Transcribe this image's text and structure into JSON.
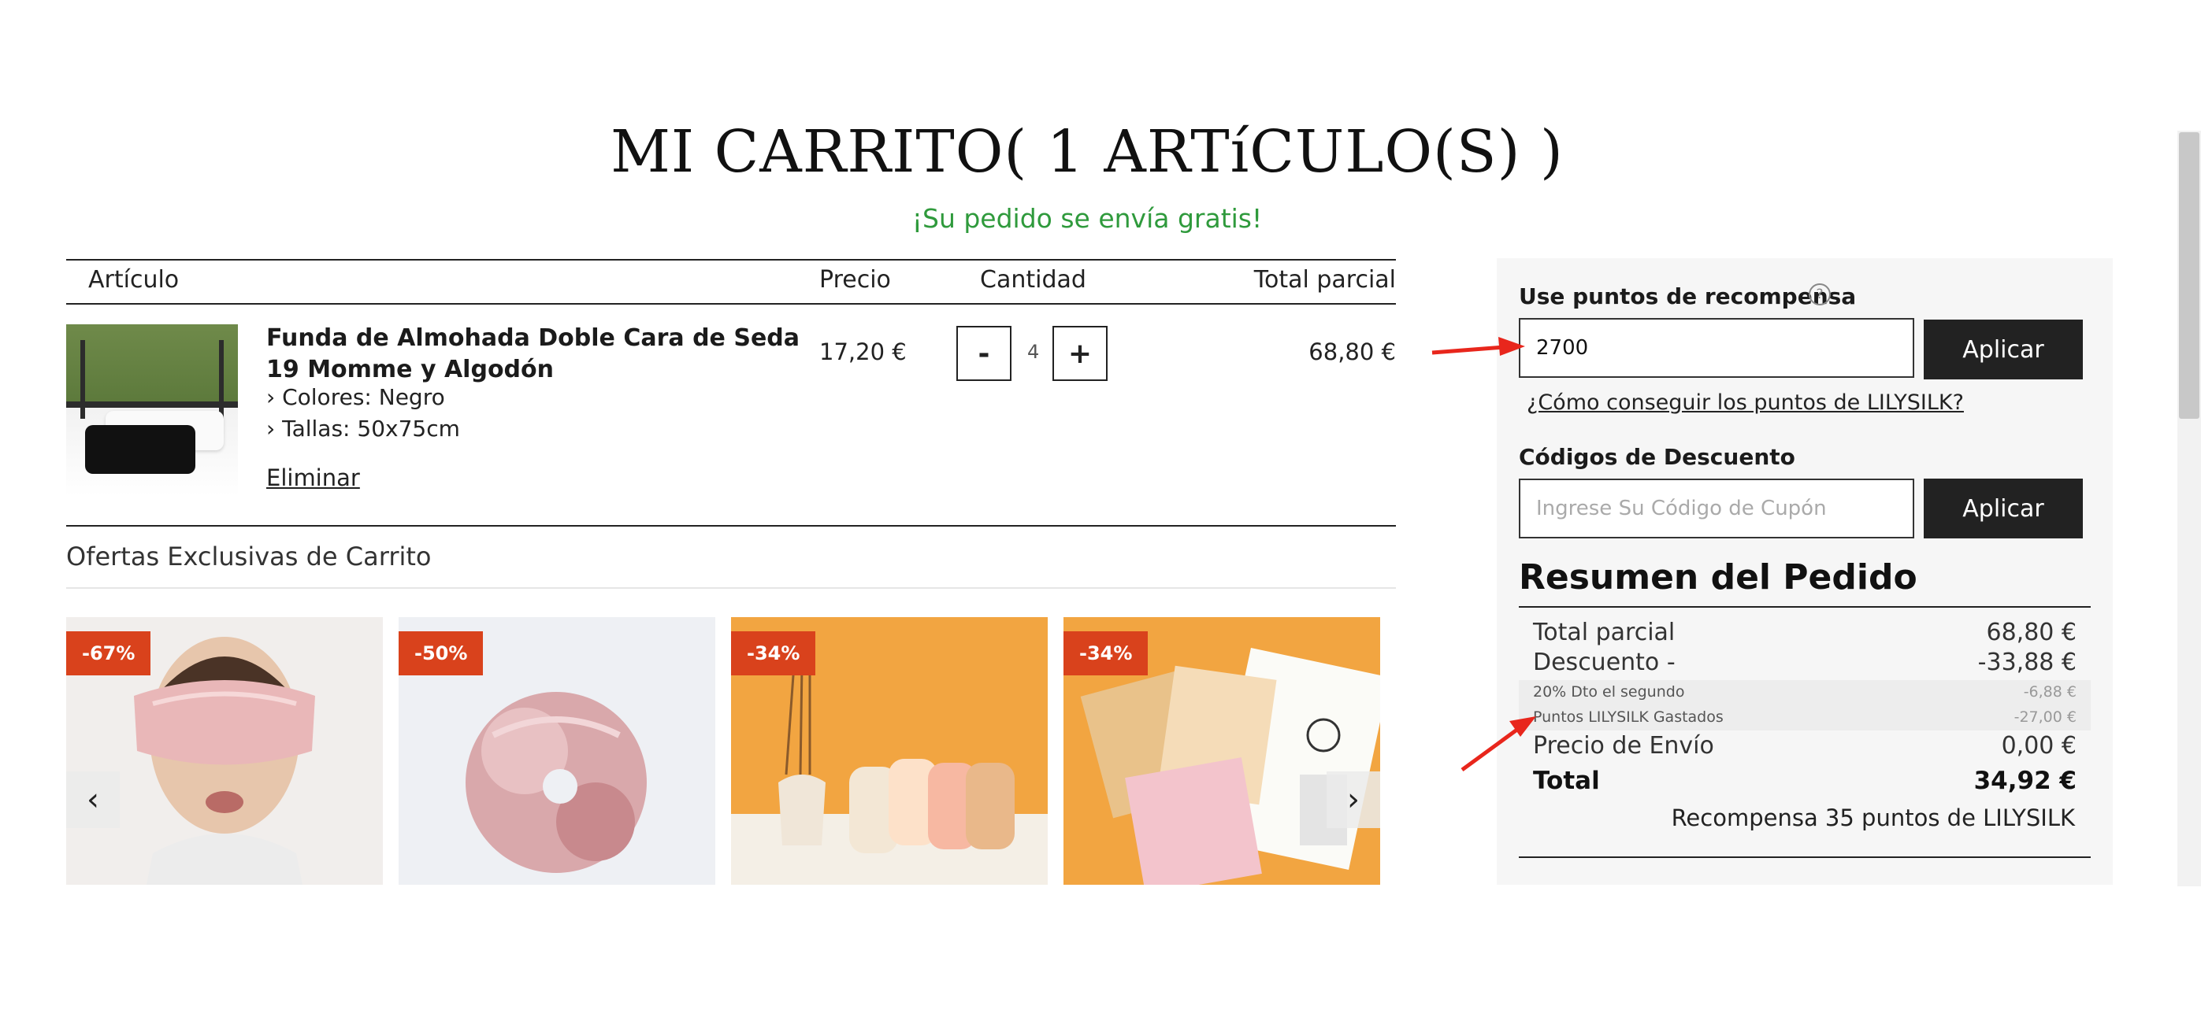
{
  "header": {
    "title": "MI CARRITO( 1 ARTíCULO(S) )",
    "shipping_notice": "¡Su pedido se envía gratis!"
  },
  "table": {
    "headers": {
      "item": "Artículo",
      "price": "Precio",
      "quantity": "Cantidad",
      "subtotal": "Total parcial"
    }
  },
  "cart_item": {
    "name": "Funda de Almohada Doble Cara de Seda 19 Momme y Algodón",
    "color_label": "› Colores:",
    "color_value": "Negro",
    "size_label": "› Tallas:",
    "size_value": "50x75cm",
    "remove_label": "Eliminar",
    "price": "17,20 €",
    "quantity": "4",
    "minus": "-",
    "plus": "+",
    "subtotal": "68,80 €"
  },
  "offers": {
    "title": "Ofertas Exclusivas de Carrito",
    "items": [
      {
        "badge": "-67%",
        "icon": "silk-eye-mask-image"
      },
      {
        "badge": "-50%",
        "icon": "silk-scrunchie-image"
      },
      {
        "badge": "-34%",
        "icon": "silk-hair-wraps-image"
      },
      {
        "badge": "-34%",
        "icon": "silk-pouches-image"
      }
    ],
    "prev": "‹",
    "next": "›"
  },
  "rewards": {
    "label": "Use puntos de recompensa",
    "help": "?",
    "value": "2700",
    "apply": "Aplicar",
    "how_link": "¿Cómo conseguir los puntos de LILYSILK?"
  },
  "coupon": {
    "label": "Códigos de Descuento",
    "placeholder": "Ingrese Su Código de Cupón",
    "apply": "Aplicar"
  },
  "summary": {
    "title": "Resumen del Pedido",
    "subtotal_label": "Total parcial",
    "subtotal_value": "68,80 €",
    "discount_label": "Descuento -",
    "discount_value": "-33,88 €",
    "second_label": "20% Dto el segundo",
    "second_value": "-6,88 €",
    "points_label": "Puntos LILYSILK Gastados",
    "points_value": "-27,00 €",
    "shipping_label": "Precio de Envío",
    "shipping_value": "0,00 €",
    "total_label": "Total",
    "total_value": "34,92 €",
    "reward_text": "Recompensa 35 puntos de LILYSILK"
  },
  "colors": {
    "accent_green": "#2f9a3c",
    "badge_red": "#d9421c",
    "button_dark": "#222222",
    "annotation_red": "#e8261c"
  }
}
